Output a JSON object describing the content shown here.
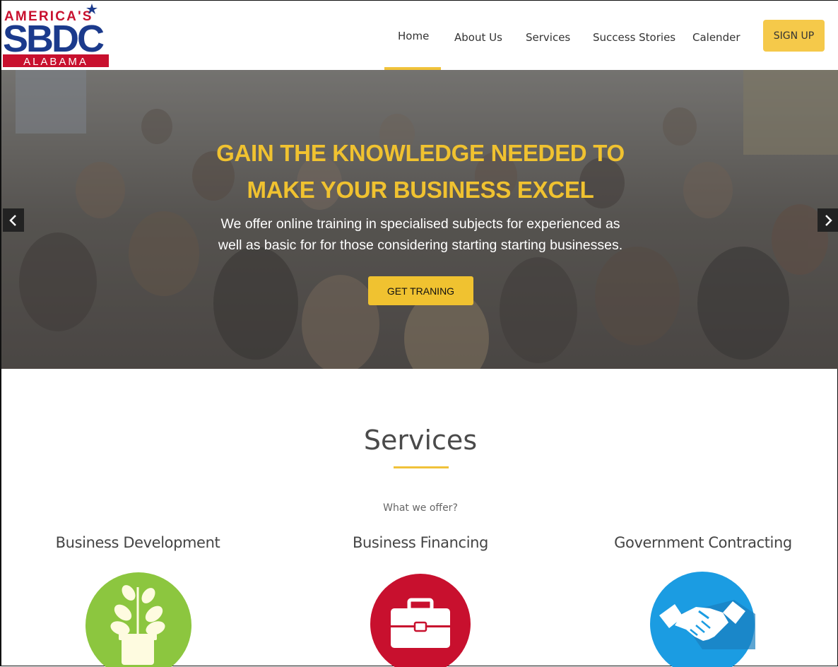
{
  "logo": {
    "top_text": "AMERICA'S",
    "main_text": "SBDC",
    "bottom_text": "ALABAMA"
  },
  "nav": {
    "items": [
      {
        "label": "Home",
        "active": true
      },
      {
        "label": "About Us"
      },
      {
        "label": "Services"
      },
      {
        "label": "Success Stories"
      },
      {
        "label": "Calender"
      }
    ],
    "signup_label": "SIGN UP"
  },
  "hero": {
    "title_line1": "GAIN THE KNOWLEDGE NEEDED TO",
    "title_line2": "MAKE YOUR BUSINESS EXCEL",
    "subtitle_line1": "We offer online training in specialised subjects for experienced as",
    "subtitle_line2": "well as basic for for those considering starting starting businesses.",
    "button_label": "GET TRANING",
    "prev_icon": "chevron-left-icon",
    "next_icon": "chevron-right-icon"
  },
  "services": {
    "title": "Services",
    "subtitle": "What we offer?",
    "items": [
      {
        "title": "Business Development",
        "icon": "plant-icon",
        "color": "#8cc63f"
      },
      {
        "title": "Business Financing",
        "icon": "briefcase-icon",
        "color": "#c8102e"
      },
      {
        "title": "Government Contracting",
        "icon": "handshake-icon",
        "color": "#1b9ce2"
      }
    ]
  },
  "colors": {
    "accent": "#f0c230",
    "brand_blue": "#1b3a8c",
    "brand_red": "#c8102e"
  }
}
